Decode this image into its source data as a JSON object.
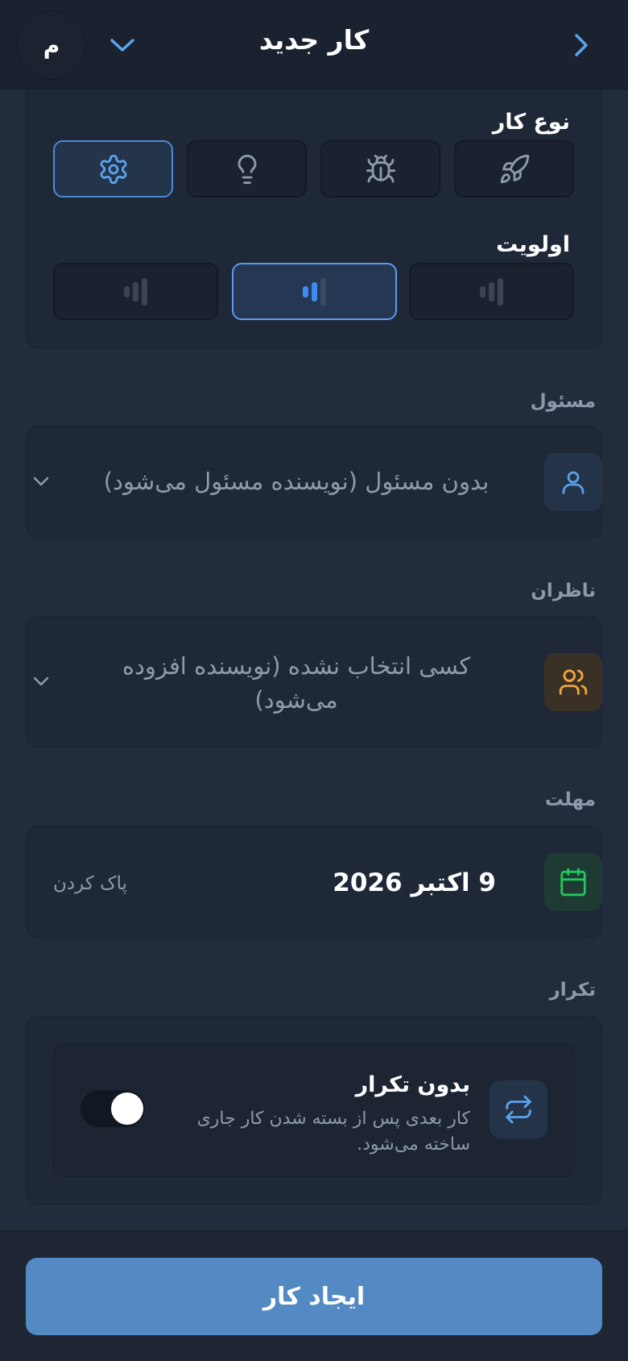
{
  "header": {
    "title": "کار جدید",
    "avatar_initial": "م"
  },
  "task_type": {
    "label": "نوع کار",
    "options": [
      {
        "icon": "rocket-icon",
        "selected": false
      },
      {
        "icon": "bug-icon",
        "selected": false
      },
      {
        "icon": "lightbulb-icon",
        "selected": false
      },
      {
        "icon": "gear-icon",
        "selected": true
      }
    ]
  },
  "priority": {
    "label": "اولویت",
    "options": [
      {
        "icon": "priority-bars-icon",
        "selected": false
      },
      {
        "icon": "priority-bars-icon",
        "selected": true
      },
      {
        "icon": "priority-bars-icon",
        "selected": false
      }
    ]
  },
  "assignee": {
    "label": "مسئول",
    "value": "بدون مسئول (نویسنده مسئول می‌شود)",
    "icon": "user-icon"
  },
  "watchers": {
    "label": "ناظران",
    "value": "کسی انتخاب نشده (نویسنده افزوده می‌شود)",
    "icon": "users-icon"
  },
  "deadline": {
    "label": "مهلت",
    "value": "9 اکتبر 2026",
    "clear_label": "پاک کردن",
    "icon": "calendar-icon"
  },
  "repeat": {
    "label": "تکرار",
    "title": "بدون تکرار",
    "description": "کار بعدی پس از بسته شدن کار جاری ساخته می‌شود.",
    "toggle_on": true,
    "icon": "repeat-icon"
  },
  "footer": {
    "submit_label": "ایجاد کار"
  },
  "colors": {
    "background": "#222c3c",
    "accent": "#538ac4",
    "selected_border": "#5b9cf2",
    "orange": "#f0a43a",
    "green": "#22c55e"
  }
}
